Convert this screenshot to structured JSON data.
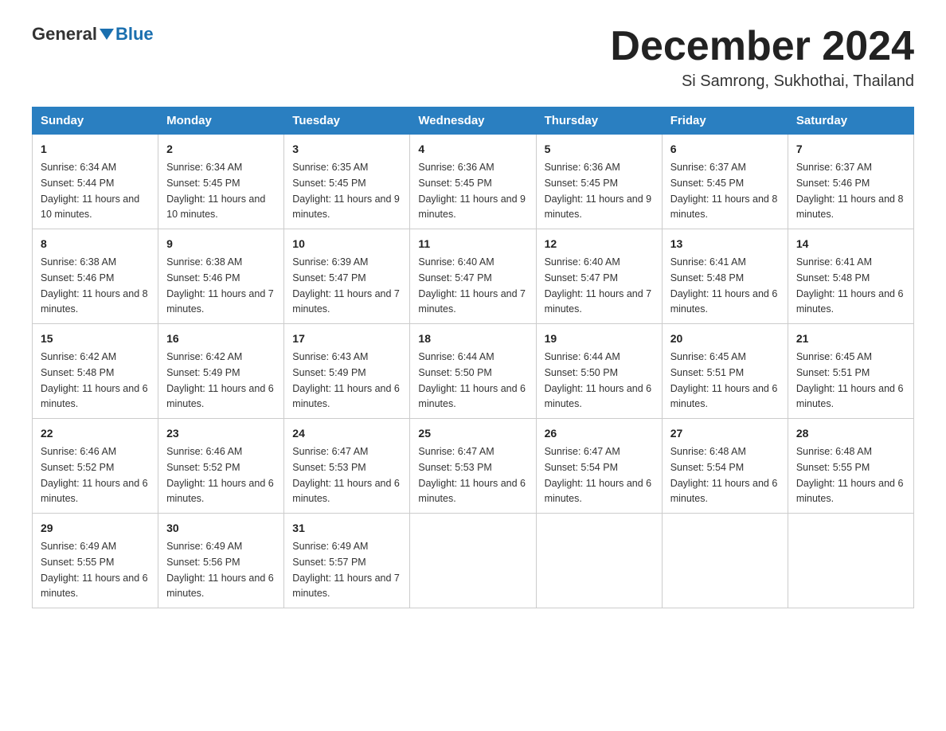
{
  "logo": {
    "general": "General",
    "blue": "Blue"
  },
  "header": {
    "month": "December 2024",
    "location": "Si Samrong, Sukhothai, Thailand"
  },
  "weekdays": [
    "Sunday",
    "Monday",
    "Tuesday",
    "Wednesday",
    "Thursday",
    "Friday",
    "Saturday"
  ],
  "weeks": [
    [
      {
        "day": "1",
        "sunrise": "6:34 AM",
        "sunset": "5:44 PM",
        "daylight": "11 hours and 10 minutes."
      },
      {
        "day": "2",
        "sunrise": "6:34 AM",
        "sunset": "5:45 PM",
        "daylight": "11 hours and 10 minutes."
      },
      {
        "day": "3",
        "sunrise": "6:35 AM",
        "sunset": "5:45 PM",
        "daylight": "11 hours and 9 minutes."
      },
      {
        "day": "4",
        "sunrise": "6:36 AM",
        "sunset": "5:45 PM",
        "daylight": "11 hours and 9 minutes."
      },
      {
        "day": "5",
        "sunrise": "6:36 AM",
        "sunset": "5:45 PM",
        "daylight": "11 hours and 9 minutes."
      },
      {
        "day": "6",
        "sunrise": "6:37 AM",
        "sunset": "5:45 PM",
        "daylight": "11 hours and 8 minutes."
      },
      {
        "day": "7",
        "sunrise": "6:37 AM",
        "sunset": "5:46 PM",
        "daylight": "11 hours and 8 minutes."
      }
    ],
    [
      {
        "day": "8",
        "sunrise": "6:38 AM",
        "sunset": "5:46 PM",
        "daylight": "11 hours and 8 minutes."
      },
      {
        "day": "9",
        "sunrise": "6:38 AM",
        "sunset": "5:46 PM",
        "daylight": "11 hours and 7 minutes."
      },
      {
        "day": "10",
        "sunrise": "6:39 AM",
        "sunset": "5:47 PM",
        "daylight": "11 hours and 7 minutes."
      },
      {
        "day": "11",
        "sunrise": "6:40 AM",
        "sunset": "5:47 PM",
        "daylight": "11 hours and 7 minutes."
      },
      {
        "day": "12",
        "sunrise": "6:40 AM",
        "sunset": "5:47 PM",
        "daylight": "11 hours and 7 minutes."
      },
      {
        "day": "13",
        "sunrise": "6:41 AM",
        "sunset": "5:48 PM",
        "daylight": "11 hours and 6 minutes."
      },
      {
        "day": "14",
        "sunrise": "6:41 AM",
        "sunset": "5:48 PM",
        "daylight": "11 hours and 6 minutes."
      }
    ],
    [
      {
        "day": "15",
        "sunrise": "6:42 AM",
        "sunset": "5:48 PM",
        "daylight": "11 hours and 6 minutes."
      },
      {
        "day": "16",
        "sunrise": "6:42 AM",
        "sunset": "5:49 PM",
        "daylight": "11 hours and 6 minutes."
      },
      {
        "day": "17",
        "sunrise": "6:43 AM",
        "sunset": "5:49 PM",
        "daylight": "11 hours and 6 minutes."
      },
      {
        "day": "18",
        "sunrise": "6:44 AM",
        "sunset": "5:50 PM",
        "daylight": "11 hours and 6 minutes."
      },
      {
        "day": "19",
        "sunrise": "6:44 AM",
        "sunset": "5:50 PM",
        "daylight": "11 hours and 6 minutes."
      },
      {
        "day": "20",
        "sunrise": "6:45 AM",
        "sunset": "5:51 PM",
        "daylight": "11 hours and 6 minutes."
      },
      {
        "day": "21",
        "sunrise": "6:45 AM",
        "sunset": "5:51 PM",
        "daylight": "11 hours and 6 minutes."
      }
    ],
    [
      {
        "day": "22",
        "sunrise": "6:46 AM",
        "sunset": "5:52 PM",
        "daylight": "11 hours and 6 minutes."
      },
      {
        "day": "23",
        "sunrise": "6:46 AM",
        "sunset": "5:52 PM",
        "daylight": "11 hours and 6 minutes."
      },
      {
        "day": "24",
        "sunrise": "6:47 AM",
        "sunset": "5:53 PM",
        "daylight": "11 hours and 6 minutes."
      },
      {
        "day": "25",
        "sunrise": "6:47 AM",
        "sunset": "5:53 PM",
        "daylight": "11 hours and 6 minutes."
      },
      {
        "day": "26",
        "sunrise": "6:47 AM",
        "sunset": "5:54 PM",
        "daylight": "11 hours and 6 minutes."
      },
      {
        "day": "27",
        "sunrise": "6:48 AM",
        "sunset": "5:54 PM",
        "daylight": "11 hours and 6 minutes."
      },
      {
        "day": "28",
        "sunrise": "6:48 AM",
        "sunset": "5:55 PM",
        "daylight": "11 hours and 6 minutes."
      }
    ],
    [
      {
        "day": "29",
        "sunrise": "6:49 AM",
        "sunset": "5:55 PM",
        "daylight": "11 hours and 6 minutes."
      },
      {
        "day": "30",
        "sunrise": "6:49 AM",
        "sunset": "5:56 PM",
        "daylight": "11 hours and 6 minutes."
      },
      {
        "day": "31",
        "sunrise": "6:49 AM",
        "sunset": "5:57 PM",
        "daylight": "11 hours and 7 minutes."
      },
      null,
      null,
      null,
      null
    ]
  ]
}
